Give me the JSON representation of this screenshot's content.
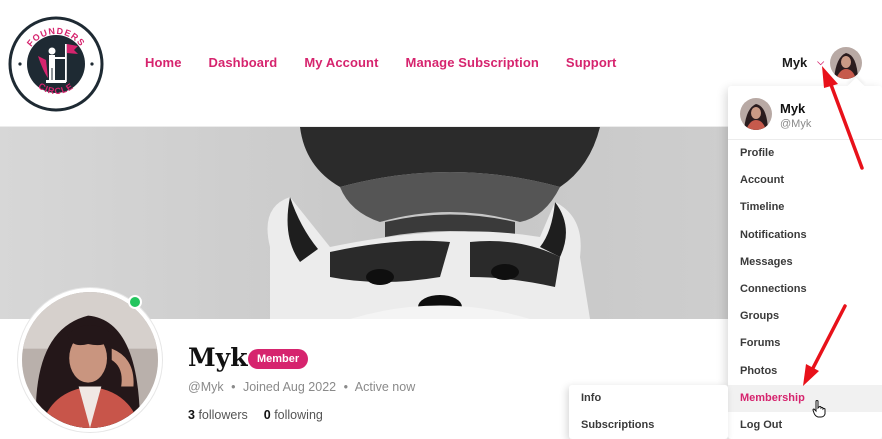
{
  "brand": {
    "logo_top_text": "FOUNDERS",
    "logo_bottom_text": "CIRCLE"
  },
  "nav": {
    "items": [
      {
        "label": "Home"
      },
      {
        "label": "Dashboard"
      },
      {
        "label": "My Account"
      },
      {
        "label": "Manage Subscription"
      },
      {
        "label": "Support"
      }
    ]
  },
  "user_menu": {
    "name": "Myk",
    "chevron_icon": "chevron-down-icon"
  },
  "profile": {
    "display_name": "Myk",
    "badge": "Member",
    "handle": "@Myk",
    "joined": "Joined Aug 2022",
    "status": "Active now",
    "separator": "•",
    "followers_count": "3",
    "followers_label": "followers",
    "following_count": "0",
    "following_label": "following",
    "online_color": "#23c55e"
  },
  "dropdown": {
    "name": "Myk",
    "handle": "@Myk",
    "items": [
      {
        "label": "Profile"
      },
      {
        "label": "Account"
      },
      {
        "label": "Timeline"
      },
      {
        "label": "Notifications"
      },
      {
        "label": "Messages"
      },
      {
        "label": "Connections"
      },
      {
        "label": "Groups"
      },
      {
        "label": "Forums"
      },
      {
        "label": "Photos"
      },
      {
        "label": "Membership",
        "active": true
      },
      {
        "label": "Log Out"
      }
    ]
  },
  "submenu": {
    "items": [
      {
        "label": "Info"
      },
      {
        "label": "Subscriptions"
      }
    ]
  },
  "colors": {
    "accent": "#d6246e",
    "annotation_arrow": "#e8111a"
  }
}
